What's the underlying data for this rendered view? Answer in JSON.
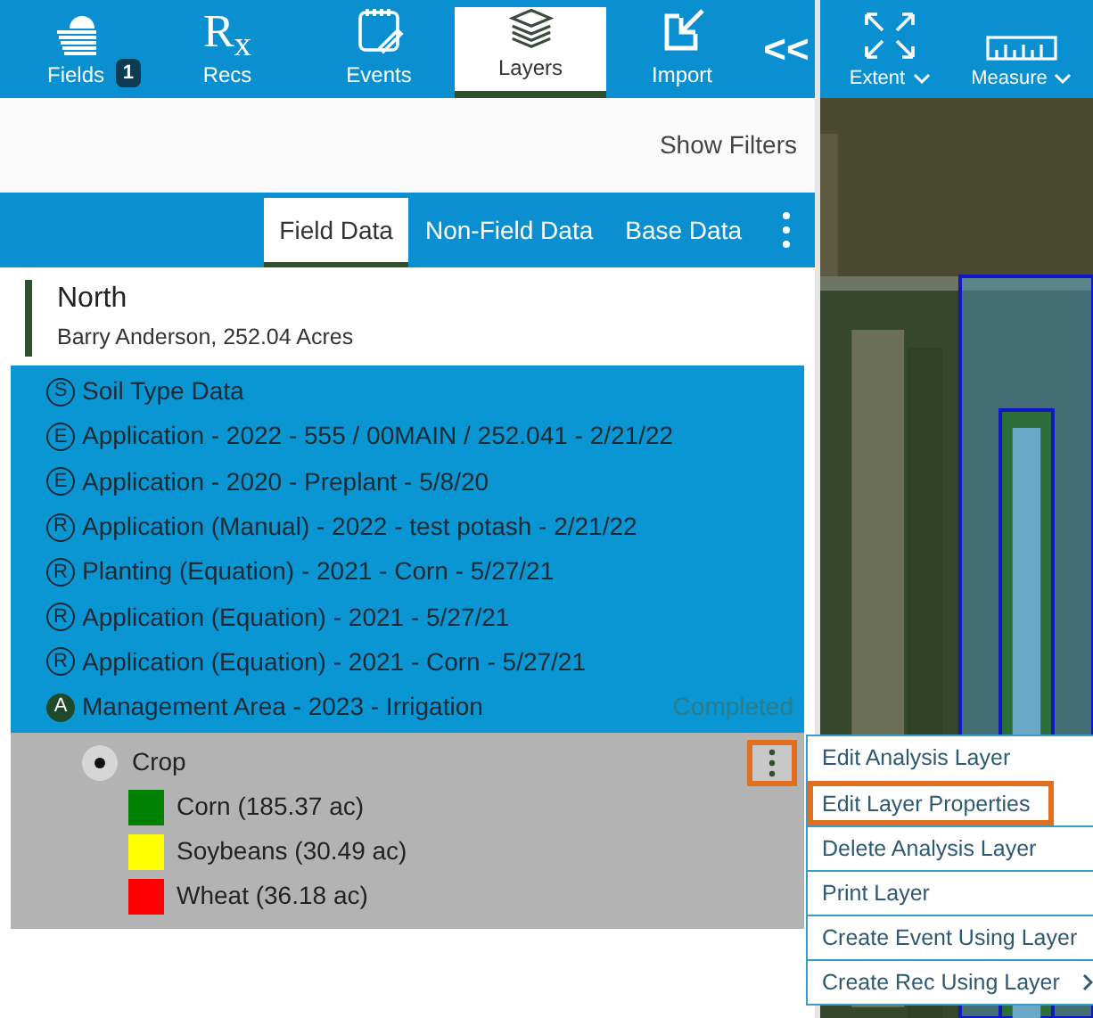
{
  "nav_tabs": [
    {
      "label": "Fields",
      "kind": "fields",
      "badge": "1",
      "selected": false
    },
    {
      "label": "Recs",
      "kind": "rx",
      "icon_text": "R$_{x}$",
      "selected": false
    },
    {
      "label": "Events",
      "kind": "events",
      "selected": false
    },
    {
      "label": "Layers",
      "kind": "layers",
      "selected": true
    },
    {
      "label": "Import",
      "kind": "import",
      "selected": false
    }
  ],
  "collapse_button": "<<",
  "map_tools": [
    {
      "label": "Extent",
      "kind": "extent"
    },
    {
      "label": "Measure",
      "kind": "ruler"
    }
  ],
  "filters_link": "Show Filters",
  "data_tabs": [
    {
      "label": "Field Data",
      "selected": true
    },
    {
      "label": "Non-Field Data",
      "selected": false
    },
    {
      "label": "Base Data",
      "selected": false
    }
  ],
  "field": {
    "name": "North",
    "details": "Barry Anderson, 252.04 Acres"
  },
  "layers": [
    {
      "badge": "S",
      "filled": false,
      "label": "Soil Type Data"
    },
    {
      "badge": "E",
      "filled": false,
      "label": "Application - 2022 - 555 / 00MAIN / 252.041 - 2/21/22"
    },
    {
      "badge": "E",
      "filled": false,
      "label": "Application - 2020 - Preplant - 5/8/20"
    },
    {
      "badge": "R",
      "filled": false,
      "label": "Application (Manual) - 2022 - test potash - 2/21/22"
    },
    {
      "badge": "R",
      "filled": false,
      "label": "Planting (Equation) - 2021 - Corn - 5/27/21"
    },
    {
      "badge": "R",
      "filled": false,
      "label": "Application (Equation) - 2021 - 5/27/21"
    },
    {
      "badge": "R",
      "filled": false,
      "label": "Application (Equation) - 2021 - Corn - 5/27/21"
    },
    {
      "badge": "A",
      "filled": true,
      "label": "Management Area - 2023 - Irrigation",
      "status": "Completed"
    }
  ],
  "sublayer": {
    "label": "Crop",
    "selected": true,
    "kebab_highlighted": true,
    "legend": [
      {
        "label": "Corn (185.37 ac)",
        "color": "#008000"
      },
      {
        "label": "Soybeans (30.49 ac)",
        "color": "#ffff00"
      },
      {
        "label": "Wheat (36.18 ac)",
        "color": "#ff0000"
      }
    ]
  },
  "context_menu": [
    {
      "label": "Edit Analysis Layer",
      "highlighted": false
    },
    {
      "label": "Edit Layer Properties",
      "highlighted": true
    },
    {
      "label": "Delete Analysis Layer",
      "highlighted": false
    },
    {
      "label": "Print Layer",
      "highlighted": false
    },
    {
      "label": "Create Event Using Layer",
      "highlighted": false
    },
    {
      "label": "Create Rec Using Layer",
      "highlighted": false,
      "submenu": true
    }
  ]
}
